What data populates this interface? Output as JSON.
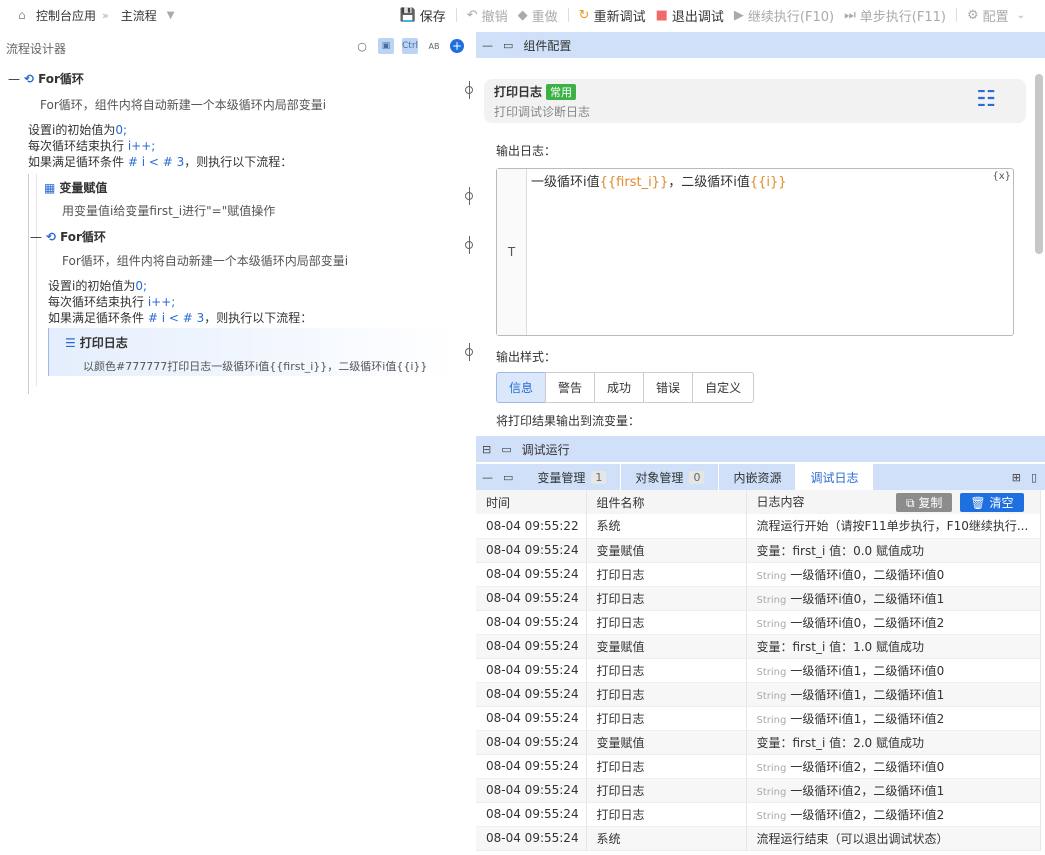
{
  "breadcrumb": {
    "home": "控制台应用",
    "current": "主流程"
  },
  "toolbar": {
    "save": "保存",
    "undo": "撤销",
    "redo": "重做",
    "restart": "重新调试",
    "exit": "退出调试",
    "continue": "继续执行(F10)",
    "step": "单步执行(F11)",
    "config": "配置"
  },
  "designer": {
    "title": "流程设计器",
    "ctrl": "Ctrl",
    "ab": "AB",
    "outer_loop": {
      "title": "For循环",
      "desc": "For循环，组件内将自动新建一个本级循环内局部变量i",
      "init": "设置i的初始值为",
      "init_val": "0;",
      "step": "每次循环结束执行",
      "step_val": "i++;",
      "cond_pre": "如果满足循环条件",
      "cond_val": "# i < # 3",
      "cond_post": "，则执行以下流程："
    },
    "assign": {
      "title": "变量赋值",
      "desc": "用变量值i给变量first_i进行\"=\"赋值操作"
    },
    "inner_loop": {
      "title": "For循环",
      "desc": "For循环，组件内将自动新建一个本级循环内局部变量i",
      "init": "设置i的初始值为",
      "init_val": "0;",
      "step": "每次循环结束执行",
      "step_val": "i++;",
      "cond_pre": "如果满足循环条件",
      "cond_val": "# i < # 3",
      "cond_post": "，则执行以下流程："
    },
    "log": {
      "title": "打印日志",
      "desc": "以颜色#777777打印日志一级循环i值{{first_i}}，二级循环i值{{i}}"
    }
  },
  "config_panel": {
    "title": "组件配置",
    "card_title": "打印日志",
    "card_badge": "常用",
    "card_sub": "打印调试诊断日志",
    "output_label": "输出日志：",
    "gutter": "T",
    "editor_text_1": "一级循环i值",
    "editor_var_1": "{{first_i}}",
    "editor_text_2": "，二级循环i值",
    "editor_var_2": "{{i}}",
    "editor_x": "{x}",
    "style_label": "输出样式：",
    "styles": [
      "信息",
      "警告",
      "成功",
      "错误",
      "自定义"
    ],
    "flow_var_label": "将打印结果输出到流变量："
  },
  "debug_panel": {
    "title": "调试运行",
    "tabs": [
      {
        "label": "变量管理",
        "count": "1"
      },
      {
        "label": "对象管理",
        "count": "0"
      },
      {
        "label": "内嵌资源",
        "count": ""
      },
      {
        "label": "调试日志",
        "count": ""
      }
    ],
    "columns": [
      "时间",
      "组件名称",
      "日志内容"
    ],
    "copy": "复制",
    "clear": "清空",
    "rows": [
      {
        "time": "08-04 09:55:22",
        "comp": "系统",
        "tag": "",
        "content": "流程运行开始（请按F11单步执行，F10继续执行..."
      },
      {
        "time": "08-04 09:55:24",
        "comp": "变量赋值",
        "tag": "",
        "content": "变量：first_i 值：0.0 赋值成功"
      },
      {
        "time": "08-04 09:55:24",
        "comp": "打印日志",
        "tag": "String",
        "content": "一级循环i值0，二级循环i值0"
      },
      {
        "time": "08-04 09:55:24",
        "comp": "打印日志",
        "tag": "String",
        "content": "一级循环i值0，二级循环i值1"
      },
      {
        "time": "08-04 09:55:24",
        "comp": "打印日志",
        "tag": "String",
        "content": "一级循环i值0，二级循环i值2"
      },
      {
        "time": "08-04 09:55:24",
        "comp": "变量赋值",
        "tag": "",
        "content": "变量：first_i 值：1.0 赋值成功"
      },
      {
        "time": "08-04 09:55:24",
        "comp": "打印日志",
        "tag": "String",
        "content": "一级循环i值1，二级循环i值0"
      },
      {
        "time": "08-04 09:55:24",
        "comp": "打印日志",
        "tag": "String",
        "content": "一级循环i值1，二级循环i值1"
      },
      {
        "time": "08-04 09:55:24",
        "comp": "打印日志",
        "tag": "String",
        "content": "一级循环i值1，二级循环i值2"
      },
      {
        "time": "08-04 09:55:24",
        "comp": "变量赋值",
        "tag": "",
        "content": "变量：first_i 值：2.0 赋值成功"
      },
      {
        "time": "08-04 09:55:24",
        "comp": "打印日志",
        "tag": "String",
        "content": "一级循环i值2，二级循环i值0"
      },
      {
        "time": "08-04 09:55:24",
        "comp": "打印日志",
        "tag": "String",
        "content": "一级循环i值2，二级循环i值1"
      },
      {
        "time": "08-04 09:55:24",
        "comp": "打印日志",
        "tag": "String",
        "content": "一级循环i值2，二级循环i值2"
      },
      {
        "time": "08-04 09:55:24",
        "comp": "系统",
        "tag": "",
        "content": "流程运行结束（可以退出调试状态）"
      }
    ]
  }
}
